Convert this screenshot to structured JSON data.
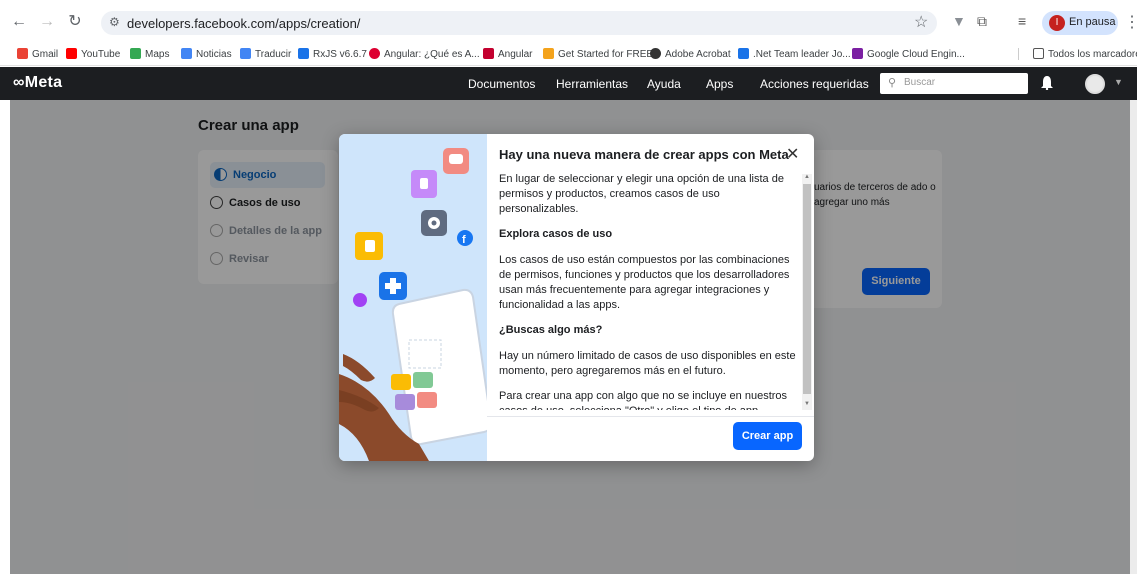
{
  "browser": {
    "url": "developers.facebook.com/apps/creation/",
    "profile_status": "En pausa",
    "profile_initial": "I"
  },
  "bookmarks": {
    "items": [
      {
        "label": "Gmail",
        "color": "#ea4335"
      },
      {
        "label": "YouTube",
        "color": "#ff0000"
      },
      {
        "label": "Maps",
        "color": "#34a853"
      },
      {
        "label": "Noticias",
        "color": "#4285f4"
      },
      {
        "label": "Traducir",
        "color": "#4285f4"
      },
      {
        "label": "RxJS v6.6.7",
        "color": "#1a73e8"
      },
      {
        "label": "Angular: ¿Qué es A...",
        "color": "#dd0031"
      },
      {
        "label": "Angular",
        "color": "#c3002f"
      },
      {
        "label": "Get Started for FREE",
        "color": "#f4a31c"
      },
      {
        "label": "Adobe Acrobat",
        "color": "#333333"
      },
      {
        "label": ".Net Team leader Jo...",
        "color": "#1a73e8"
      },
      {
        "label": "Google Cloud Engin...",
        "color": "#7b1fa2"
      }
    ],
    "all_bookmarks": "Todos los marcadores"
  },
  "meta_nav": {
    "logo": "Meta",
    "items": [
      "Documentos",
      "Herramientas",
      "Ayuda",
      "Apps",
      "Acciones requeridas"
    ],
    "search_placeholder": "Buscar"
  },
  "page": {
    "title": "Crear una app",
    "steps": [
      "Negocio",
      "Casos de uso",
      "Detalles de la app",
      "Revisar"
    ],
    "right_text": "uarios de terceros de ado o agregar uno más",
    "next_button": "Siguiente"
  },
  "modal": {
    "title": "Hay una nueva manera de crear apps con Meta",
    "p1": "En lugar de seleccionar y elegir una opción de una lista de permisos y productos, creamos casos de uso personalizables.",
    "h1": "Explora casos de uso",
    "p2": "Los casos de uso están compuestos por las combinaciones de permisos, funciones y productos que los desarrolladores usan más frecuentemente para agregar integraciones y funcionalidad a las apps.",
    "h2": "¿Buscas algo más?",
    "p3": "Hay un número limitado de casos de uso disponibles en este momento, pero agregaremos más en el futuro.",
    "p4": "Para crear una app con algo que no se incluye en nuestros casos de uso, selecciona \"Otro\" y elige el tipo de app.",
    "create_button": "Crear app"
  }
}
